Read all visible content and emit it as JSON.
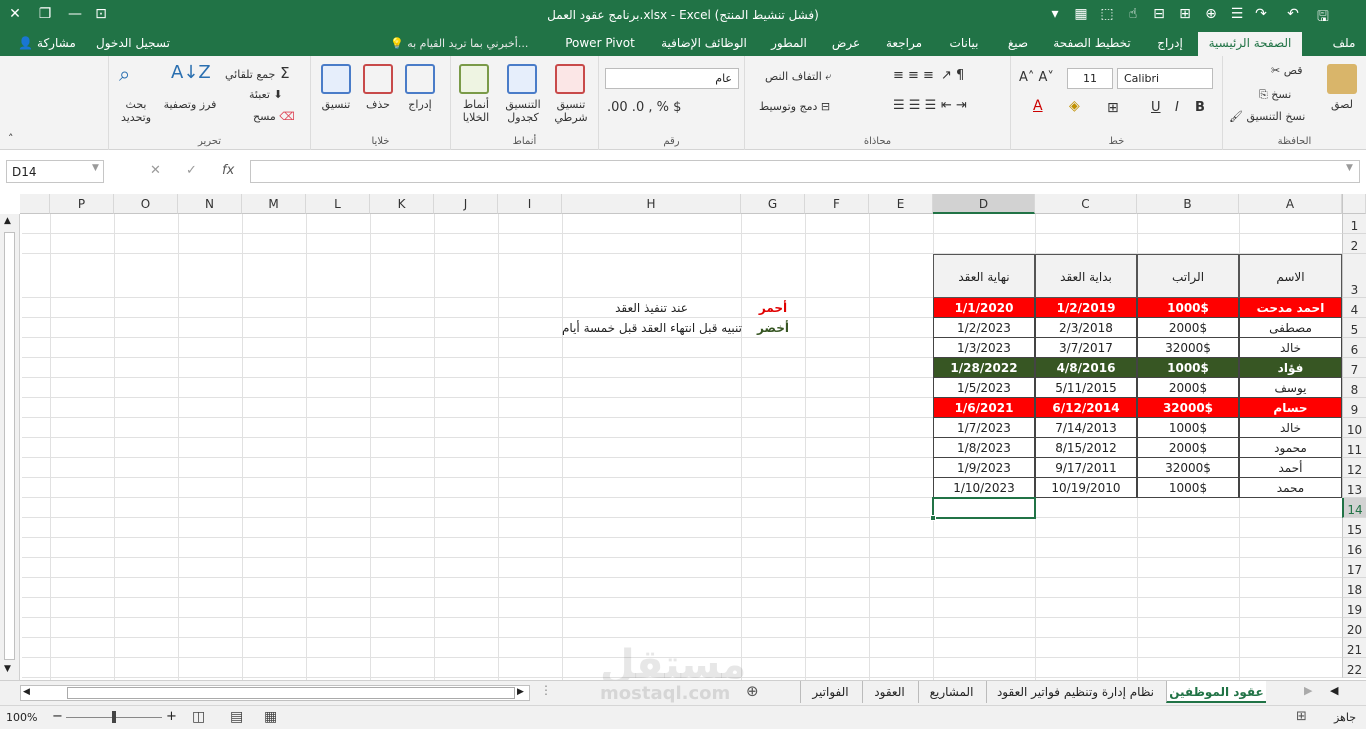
{
  "window": {
    "title": "برنامج عقود العمل.xlsx - Excel (فشل تنشيط المنتج)"
  },
  "tabs": {
    "file": "ملف",
    "home": "الصفحة الرئيسية",
    "insert": "إدراج",
    "page_layout": "تخطيط الصفحة",
    "formulas": "صيغ",
    "data": "بيانات",
    "review": "مراجعة",
    "view": "عرض",
    "developer": "المطور",
    "addins": "الوظائف الإضافية",
    "powerpivot": "Power Pivot",
    "tell_me": "أخبرني بما تريد القيام به...",
    "sign_in": "تسجيل الدخول",
    "share": "مشاركة"
  },
  "ribbon": {
    "clipboard": {
      "label": "الحافظة",
      "paste": "لصق",
      "cut": "قص",
      "copy": "نسخ",
      "format_painter": "نسخ التنسيق"
    },
    "font": {
      "label": "خط",
      "font_name": "Calibri",
      "font_size": "11"
    },
    "alignment": {
      "label": "محاذاة",
      "wrap": "التفاف النص",
      "merge": "دمج وتوسيط"
    },
    "number": {
      "label": "رقم",
      "format": "عام"
    },
    "styles": {
      "label": "أنماط",
      "conditional": "تنسيق شرطي",
      "table": "التنسيق كجدول",
      "cell_styles": "أنماط الخلايا"
    },
    "cells": {
      "label": "خلايا",
      "insert": "إدراج",
      "delete": "حذف",
      "format": "تنسيق"
    },
    "editing": {
      "label": "تحرير",
      "autosum": "جمع تلقائي",
      "fill": "تعبئة",
      "clear": "مسح",
      "sort": "فرز وتصفية",
      "find": "بحث وتحديد"
    }
  },
  "formula_bar": {
    "name_box": "D14",
    "fx": "fx",
    "value": ""
  },
  "columns": [
    "A",
    "B",
    "C",
    "D",
    "E",
    "F",
    "G",
    "H",
    "I",
    "J",
    "K",
    "L",
    "M",
    "N",
    "O",
    "P"
  ],
  "rows": [
    "1",
    "2",
    "3",
    "4",
    "5",
    "6",
    "7",
    "8",
    "9",
    "10",
    "11",
    "12",
    "13",
    "14",
    "15",
    "16",
    "17",
    "18",
    "19",
    "20",
    "21",
    "22"
  ],
  "table": {
    "headers": [
      "الاسم",
      "الراتب",
      "بداية العقد",
      "نهاية العقد"
    ],
    "rows": [
      {
        "cells": [
          "احمد مدحت",
          "1000$",
          "1/2/2019",
          "1/1/2020"
        ],
        "style": "red"
      },
      {
        "cells": [
          "مصطفى",
          "2000$",
          "2/3/2018",
          "1/2/2023"
        ],
        "style": "none"
      },
      {
        "cells": [
          "خالد",
          "32000$",
          "3/7/2017",
          "1/3/2023"
        ],
        "style": "none"
      },
      {
        "cells": [
          "فؤاد",
          "1000$",
          "4/8/2016",
          "1/28/2022"
        ],
        "style": "green"
      },
      {
        "cells": [
          "يوسف",
          "2000$",
          "5/11/2015",
          "1/5/2023"
        ],
        "style": "none"
      },
      {
        "cells": [
          "حسام",
          "32000$",
          "6/12/2014",
          "1/6/2021"
        ],
        "style": "red"
      },
      {
        "cells": [
          "خالد",
          "1000$",
          "7/14/2013",
          "1/7/2023"
        ],
        "style": "none"
      },
      {
        "cells": [
          "محمود",
          "2000$",
          "8/15/2012",
          "1/8/2023"
        ],
        "style": "none"
      },
      {
        "cells": [
          "أحمد",
          "32000$",
          "9/17/2011",
          "1/9/2023"
        ],
        "style": "none"
      },
      {
        "cells": [
          "محمد",
          "1000$",
          "10/19/2010",
          "1/10/2023"
        ],
        "style": "none"
      }
    ]
  },
  "legend": {
    "red_label": "أحمر",
    "red_text": "عند تنفيذ العقد",
    "green_label": "أخضر",
    "green_text": "تنبيه قبل انتهاء العقد قبل خمسة أيام"
  },
  "sheets": [
    "عقود الموظفين",
    "نظام إدارة وتنظيم فواتير العقود",
    "المشاريع",
    "العقود",
    "الفواتير"
  ],
  "status": {
    "ready": "جاهز",
    "zoom": "100%"
  },
  "watermark": {
    "ar": "مستقل",
    "en": "mostaql.com"
  },
  "colors": {
    "excel_green": "#217346",
    "red_fill": "#ff0000",
    "green_fill": "#375623"
  }
}
